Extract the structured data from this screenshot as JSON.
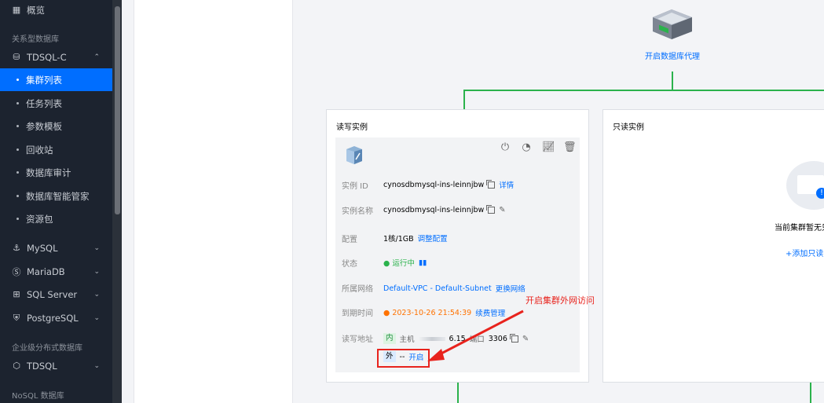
{
  "sidebar": {
    "overview": "概览",
    "section_relational": "关系型数据库",
    "tdsql_c": "TDSQL-C",
    "sub_items": [
      "集群列表",
      "任务列表",
      "参数模板",
      "回收站",
      "数据库审计",
      "数据库智能管家",
      "资源包"
    ],
    "mysql": "MySQL",
    "mariadb": "MariaDB",
    "sqlserver": "SQL Server",
    "postgresql": "PostgreSQL",
    "section_distributed": "企业级分布式数据库",
    "tdsql": "TDSQL",
    "section_nosql": "NoSQL 数据库"
  },
  "proxy": {
    "label": "开启数据库代理"
  },
  "rw_card": {
    "title": "读写实例",
    "rows": {
      "instance_id_label": "实例 ID",
      "instance_id": "cynosdbmysql-ins-leinnjbw",
      "detail_link": "详情",
      "instance_name_label": "实例名称",
      "instance_name": "cynosdbmysql-ins-leinnjbw",
      "config_label": "配置",
      "config": "1核/1GB",
      "config_link": "调整配置",
      "status_label": "状态",
      "status": "运行中",
      "network_label": "所属网络",
      "network": "Default-VPC - Default-Subnet",
      "network_link": "更换网络",
      "expire_label": "到期时间",
      "expire": "2023-10-26 21:54:39",
      "expire_link": "续费管理",
      "address_label": "读写地址",
      "inner_tag": "内",
      "host_label": "主机",
      "host_tail": "6.15",
      "port_label": "端口",
      "port": "3306",
      "outer_tag": "外",
      "outer_sep": "--",
      "outer_link": "开启"
    }
  },
  "ro_card": {
    "title": "只读实例",
    "empty_text": "当前集群暂无只",
    "add_link": "+添加只读实"
  },
  "annotation": {
    "note": "开启集群外网访问"
  },
  "colors": {
    "accent": "#006eff",
    "sidebar_bg": "#1c232f",
    "topology_line": "#2bb24c",
    "annotation": "#e8231d"
  }
}
